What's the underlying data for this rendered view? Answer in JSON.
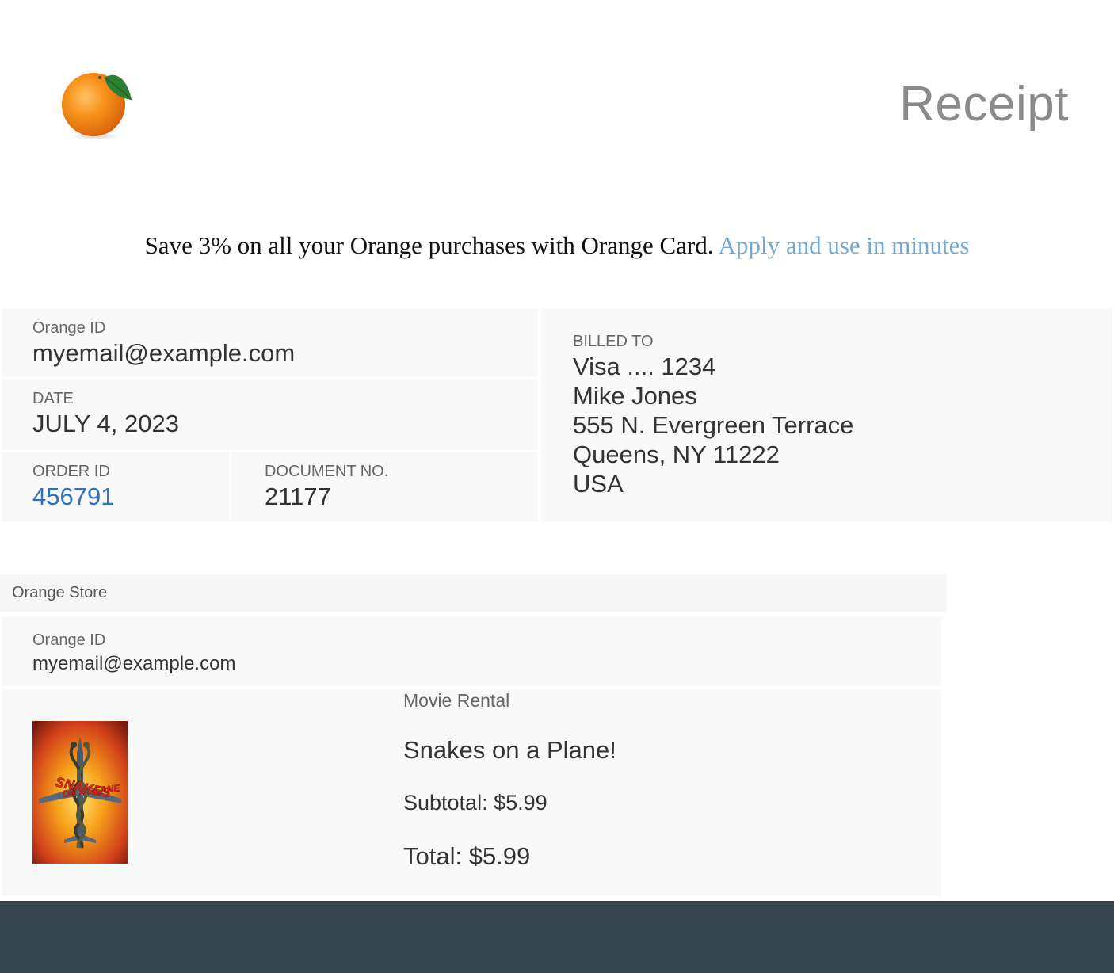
{
  "header": {
    "logo_icon": "orange-fruit-icon",
    "title": "Receipt"
  },
  "promo": {
    "text": "Save 3% on all your Orange purchases with Orange Card.",
    "link_text": "Apply and use in minutes"
  },
  "account": {
    "orange_id_label": "Orange ID",
    "orange_id": "myemail@example.com",
    "date_label": "DATE",
    "date": "JULY 4, 2023",
    "order_id_label": "ORDER ID",
    "order_id": "456791",
    "document_label": "DOCUMENT NO.",
    "document_no": "21177"
  },
  "billing": {
    "label": "BILLED TO",
    "lines": [
      "Visa .... 1234",
      "Mike Jones",
      "555 N. Evergreen Terrace",
      "Queens, NY 11222",
      "USA"
    ]
  },
  "store": {
    "name": "Orange Store",
    "orange_id_label": "Orange ID",
    "orange_id": "myemail@example.com",
    "items": [
      {
        "type": "Movie Rental",
        "name": "Snakes on a Plane!",
        "subtotal": "Subtotal: $5.99",
        "total": "Total: $5.99",
        "poster_title_line1": "SNAKES",
        "poster_title_line2": "ON A PLANE"
      }
    ]
  },
  "colors": {
    "link": "#74a8d3",
    "order_link": "#2f6fc4",
    "footer": "#37464f",
    "title": "#8a8a8a"
  }
}
